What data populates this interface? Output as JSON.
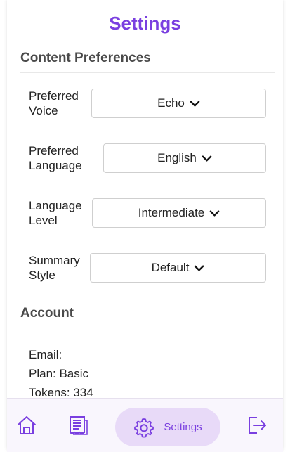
{
  "colors": {
    "accent": "#7a3fe0",
    "heading": "#4a4a4a",
    "nav_active_bg": "#e8daf8"
  },
  "header": {
    "title": "Settings"
  },
  "content_preferences": {
    "heading": "Content Preferences",
    "items": [
      {
        "label": "Preferred\nVoice",
        "value": "Echo"
      },
      {
        "label": "Preferred\nLanguage",
        "value": "English"
      },
      {
        "label": "Language\nLevel",
        "value": "Intermediate"
      },
      {
        "label": "Summary\nStyle",
        "value": "Default"
      }
    ]
  },
  "account": {
    "heading": "Account",
    "email": "Email:",
    "plan": "Plan: Basic",
    "tokens": "Tokens: 334"
  },
  "nav": {
    "items": [
      {
        "name": "home",
        "icon": "home-icon"
      },
      {
        "name": "notes",
        "icon": "document-icon"
      },
      {
        "name": "settings",
        "icon": "gear-icon",
        "label": "Settings"
      },
      {
        "name": "logout",
        "icon": "logout-icon"
      }
    ]
  }
}
